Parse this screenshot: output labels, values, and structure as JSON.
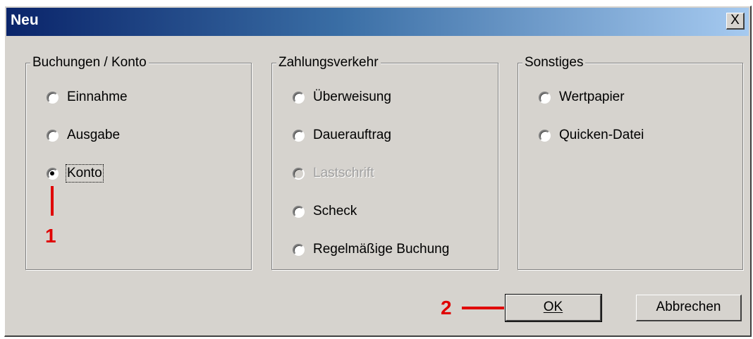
{
  "window": {
    "title": "Neu",
    "close_label": "X"
  },
  "groups": [
    {
      "label": "Buchungen / Konto",
      "options": [
        {
          "label": "Einnahme",
          "checked": false,
          "disabled": false
        },
        {
          "label": "Ausgabe",
          "checked": false,
          "disabled": false
        },
        {
          "label": "Konto",
          "checked": true,
          "disabled": false,
          "focused": true
        }
      ]
    },
    {
      "label": "Zahlungsverkehr",
      "options": [
        {
          "label": "Überweisung",
          "checked": false,
          "disabled": false
        },
        {
          "label": "Dauerauftrag",
          "checked": false,
          "disabled": false
        },
        {
          "label": "Lastschrift",
          "checked": false,
          "disabled": true
        },
        {
          "label": "Scheck",
          "checked": false,
          "disabled": false
        },
        {
          "label": "Regelmäßige Buchung",
          "checked": false,
          "disabled": false
        }
      ]
    },
    {
      "label": "Sonstiges",
      "options": [
        {
          "label": "Wertpapier",
          "checked": false,
          "disabled": false
        },
        {
          "label": "Quicken-Datei",
          "checked": false,
          "disabled": false
        }
      ]
    }
  ],
  "buttons": {
    "ok_label": "OK",
    "cancel_label": "Abbrechen"
  },
  "annotations": {
    "marker_1": "1",
    "marker_2": "2",
    "color": "#e00000"
  }
}
